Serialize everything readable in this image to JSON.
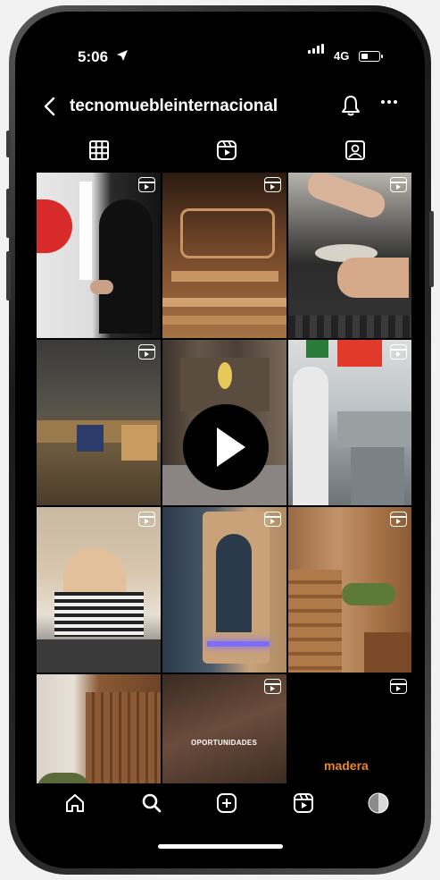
{
  "status": {
    "time": "5:06",
    "network": "4G"
  },
  "header": {
    "username": "tecnomuebleinternacional",
    "back": "<",
    "more": "···"
  },
  "tabs": [
    "grid",
    "reels",
    "tagged"
  ],
  "posts": {
    "overlays": {
      "p11_text": "OPORTUNIDADES",
      "p12_text": "madera"
    }
  },
  "colors": {
    "accent_orange": "#e8862e",
    "background": "#000000"
  },
  "bottom_nav": [
    "home",
    "search",
    "create",
    "reels",
    "profile"
  ]
}
